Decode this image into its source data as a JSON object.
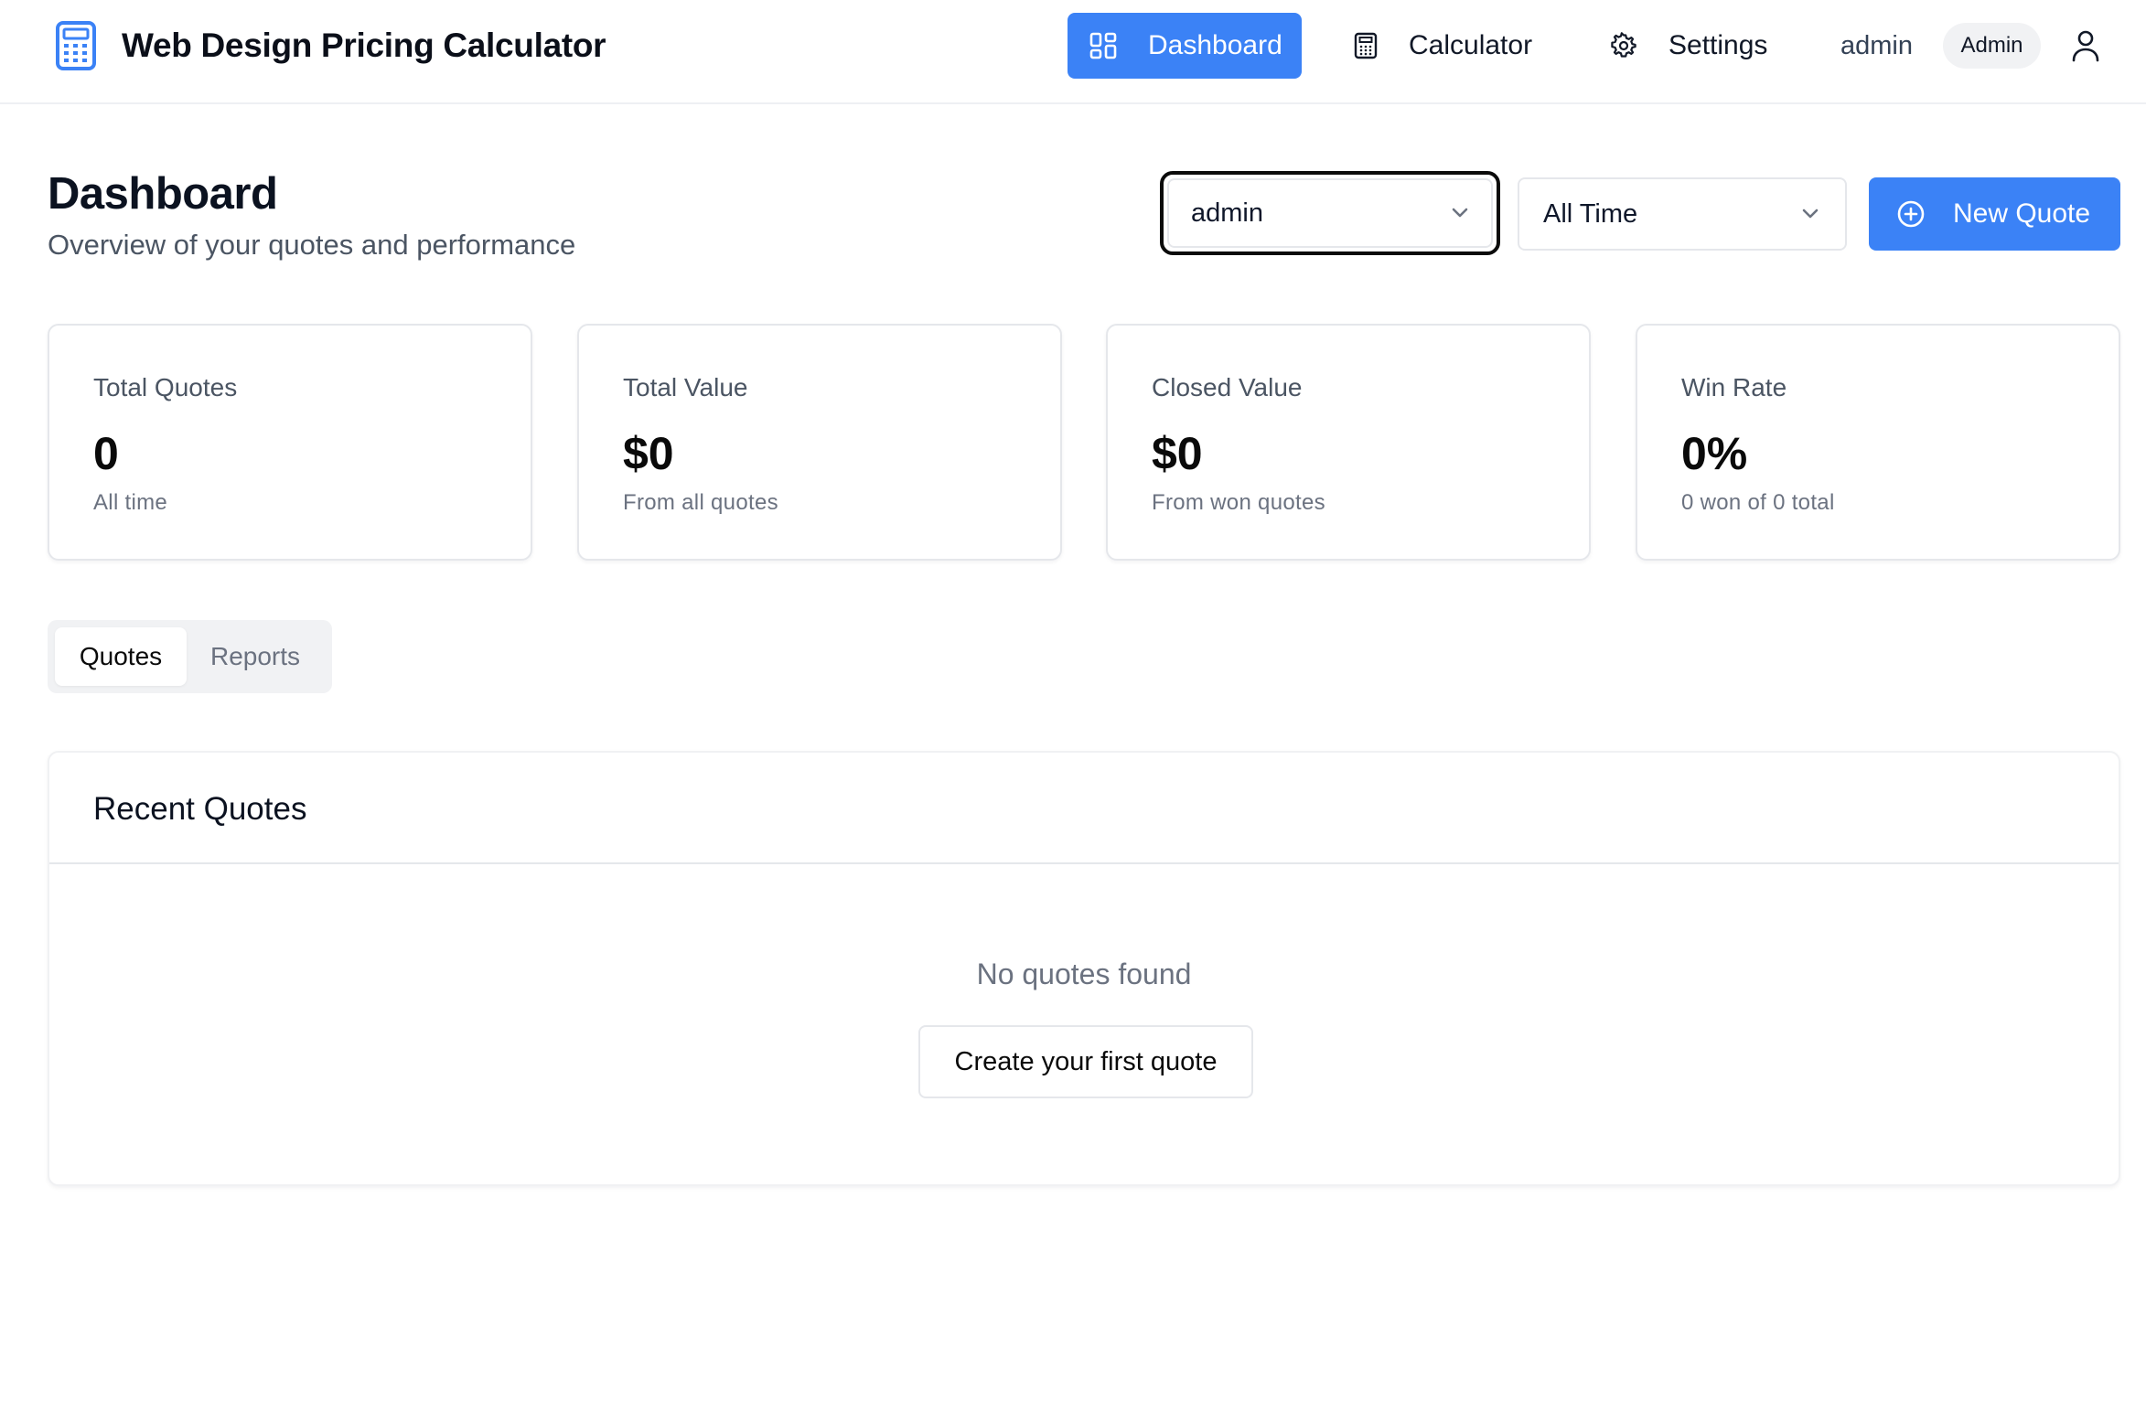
{
  "app": {
    "title": "Web Design Pricing Calculator",
    "logo_icon": "calculator-icon",
    "brand_color": "#3b82f6"
  },
  "nav": {
    "items": [
      {
        "label": "Dashboard",
        "icon": "layout-grid-icon",
        "active": true
      },
      {
        "label": "Calculator",
        "icon": "calculator-icon",
        "active": false
      },
      {
        "label": "Settings",
        "icon": "gear-icon",
        "active": false
      }
    ]
  },
  "user": {
    "name": "admin",
    "role_badge": "Admin",
    "icon": "user-icon"
  },
  "page": {
    "title": "Dashboard",
    "subtitle": "Overview of your quotes and performance"
  },
  "filters": {
    "user_select": {
      "value": "admin",
      "focused": true
    },
    "range_select": {
      "value": "All Time"
    }
  },
  "actions": {
    "new_quote_label": "New Quote",
    "new_quote_icon": "plus-circle-icon"
  },
  "stats": [
    {
      "label": "Total Quotes",
      "value": "0",
      "sub": "All time"
    },
    {
      "label": "Total Value",
      "value": "$0",
      "sub": "From all quotes"
    },
    {
      "label": "Closed Value",
      "value": "$0",
      "sub": "From won quotes"
    },
    {
      "label": "Win Rate",
      "value": "0%",
      "sub": "0 won of 0 total"
    }
  ],
  "tabs": [
    {
      "label": "Quotes",
      "active": true
    },
    {
      "label": "Reports",
      "active": false
    }
  ],
  "recent_quotes": {
    "title": "Recent Quotes",
    "empty_text": "No quotes found",
    "create_label": "Create your first quote"
  }
}
